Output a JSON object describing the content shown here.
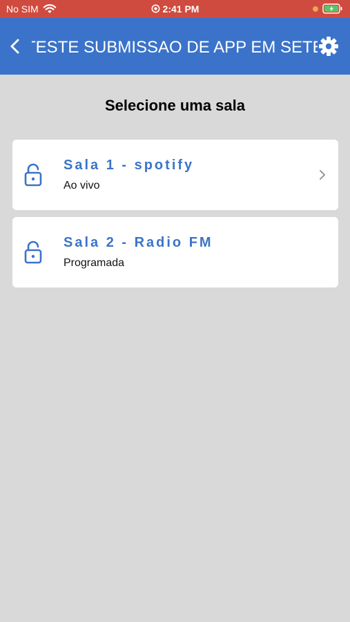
{
  "status_bar": {
    "carrier": "No SIM",
    "time": "2:41 PM",
    "icons": {
      "wifi": "wifi-icon",
      "alarm": "alarm-icon",
      "battery": "battery-charging-icon"
    }
  },
  "nav": {
    "title": "TESTE SUBMISSAO DE APP EM SETEMBRO",
    "back_icon": "chevron-left-icon",
    "settings_icon": "gear-icon",
    "color": "#3a73c9"
  },
  "main": {
    "title": "Selecione uma sala",
    "rooms": [
      {
        "name": "Sala 1 - spotify",
        "subtitle": "Ao vivo",
        "icon": "lock-open-icon",
        "has_chevron": true
      },
      {
        "name": "Sala 2 - Radio FM",
        "subtitle": "Programada",
        "icon": "lock-open-icon",
        "has_chevron": false
      }
    ]
  },
  "colors": {
    "status_bar": "#cf4b3f",
    "accent": "#3a73c9",
    "background": "#d9d9d9",
    "card": "#ffffff"
  }
}
